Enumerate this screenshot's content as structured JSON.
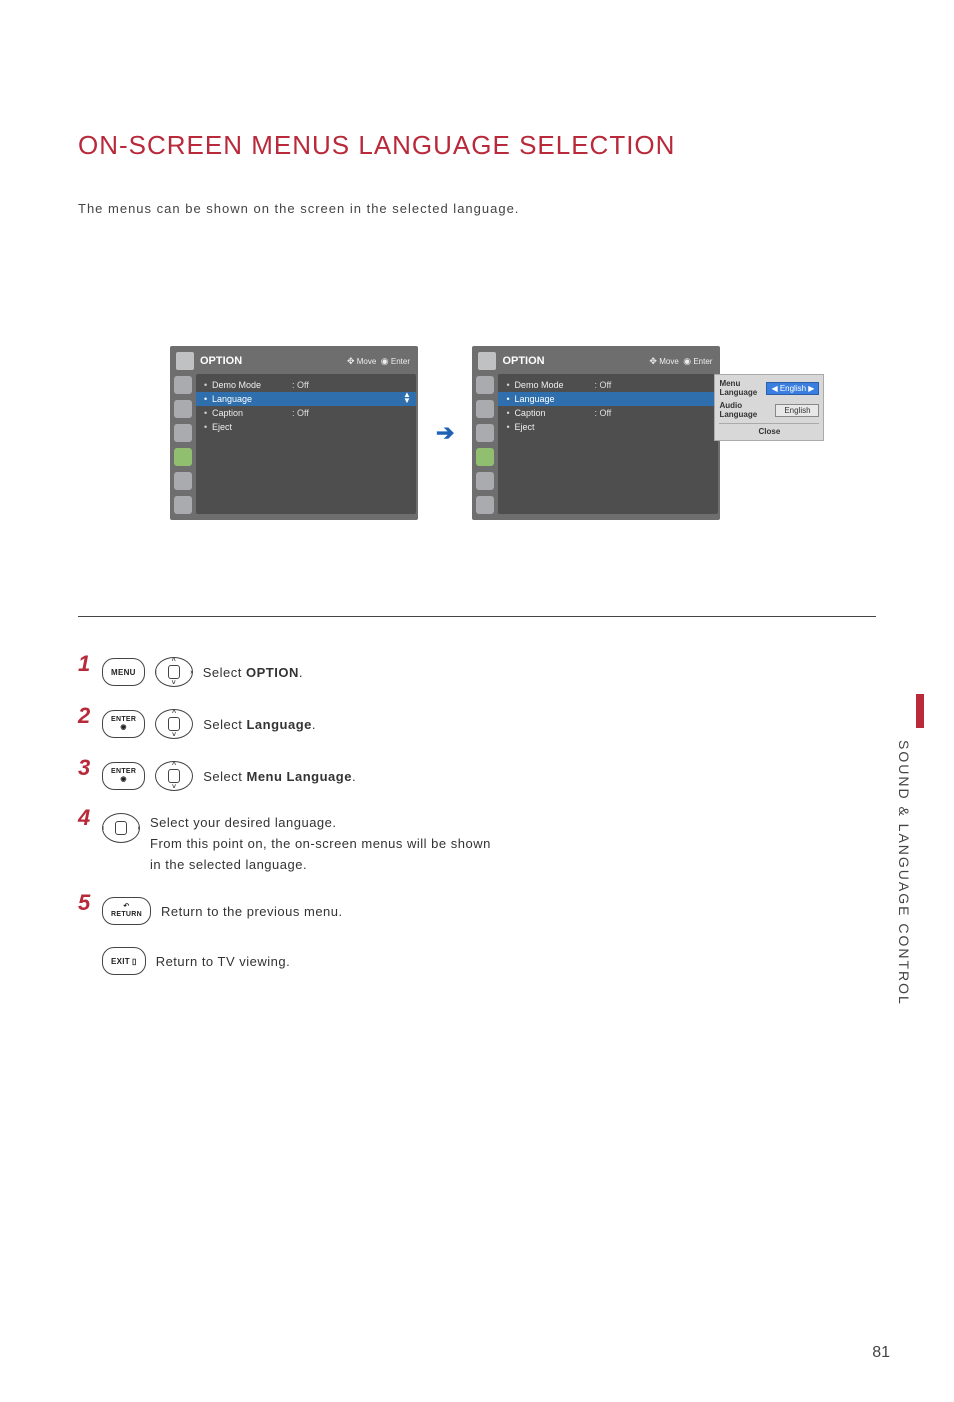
{
  "page": {
    "title": "ON-SCREEN MENUS LANGUAGE SELECTION",
    "intro": "The menus can be shown on the screen in the selected language.",
    "sideLabel": "SOUND & LANGUAGE CONTROL",
    "number": "81"
  },
  "osd": {
    "title": "OPTION",
    "hintMove": "Move",
    "hintEnter": "Enter",
    "items": [
      {
        "label": "Demo Mode",
        "value": ": Off"
      },
      {
        "label": "Language",
        "value": ""
      },
      {
        "label": "Caption",
        "value": ": Off"
      },
      {
        "label": "Eject",
        "value": ""
      }
    ]
  },
  "popup": {
    "menuLangLabel": "Menu Language",
    "menuLangValue": "◀ English ▶",
    "audioLangLabel": "Audio Language",
    "audioLangValue": "English",
    "close": "Close"
  },
  "remote": {
    "menu": "MENU",
    "enter": "ENTER",
    "return": "RETURN",
    "exit": "EXIT"
  },
  "steps": {
    "s1a": "Select ",
    "s1b": "OPTION",
    "s1c": ".",
    "s2a": "Select ",
    "s2b": "Language",
    "s2c": ".",
    "s3a": "Select ",
    "s3b": "Menu Language",
    "s3c": ".",
    "s4": "Select your desired language.\nFrom this point on, the on-screen menus will be shown in the selected language.",
    "s5": "Return to the previous menu.",
    "s6": "Return to TV viewing.",
    "n1": "1",
    "n2": "2",
    "n3": "3",
    "n4": "4",
    "n5": "5"
  }
}
